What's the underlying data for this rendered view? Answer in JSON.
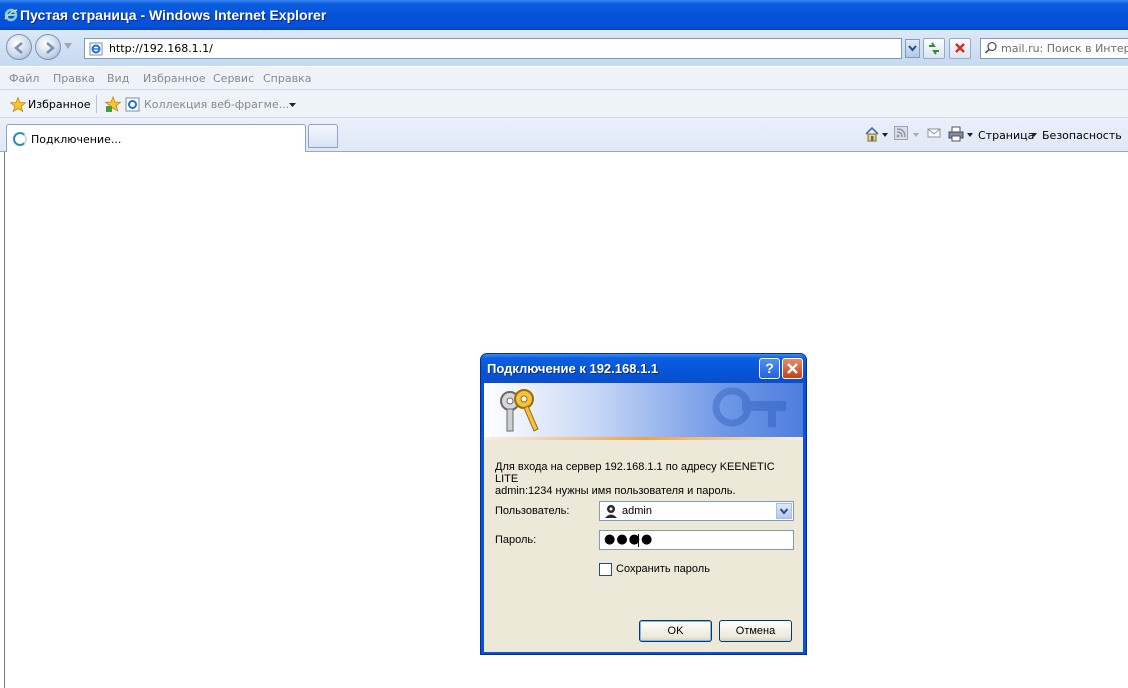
{
  "window": {
    "title": "Пустая страница - Windows Internet Explorer"
  },
  "address_bar": {
    "url": "http://192.168.1.1/"
  },
  "search": {
    "placeholder": "mail.ru: Поиск в Интерне"
  },
  "menu": {
    "items": [
      "Файл",
      "Правка",
      "Вид",
      "Избранное",
      "Сервис",
      "Справка"
    ]
  },
  "favorites_bar": {
    "favorites_label": "Избранное",
    "web_slice_label": "Коллекция веб-фрагме..."
  },
  "tabs": [
    {
      "label": "Подключение..."
    }
  ],
  "command_bar": {
    "page_label": "Страница",
    "safety_label": "Безопасность"
  },
  "dialog": {
    "title": "Подключение к 192.168.1.1",
    "message_line1": "Для входа на сервер 192.168.1.1 по адресу KEENETIC LITE",
    "message_line2": "admin:1234 нужны имя пользователя и пароль.",
    "user_label": "Пользователь:",
    "user_value": "admin",
    "password_label": "Пароль:",
    "password_mask": "●●●●",
    "remember_label": "Сохранить пароль",
    "remember_checked": false,
    "ok_label": "OK",
    "cancel_label": "Отмена"
  },
  "colors": {
    "titlebar_blue": "#0653d6",
    "dialog_body": "#ece9d8",
    "close_red": "#c4401c"
  },
  "icons": [
    "ie-logo-icon",
    "back-icon",
    "forward-icon",
    "page-icon",
    "refresh-icon",
    "stop-icon",
    "search-icon",
    "favorites-star-icon",
    "add-favorites-icon",
    "web-slice-icon",
    "loading-icon",
    "home-icon",
    "feeds-icon",
    "mail-icon",
    "print-icon",
    "keys-icon",
    "help-icon",
    "close-icon",
    "user-icon",
    "chevron-down-icon"
  ]
}
